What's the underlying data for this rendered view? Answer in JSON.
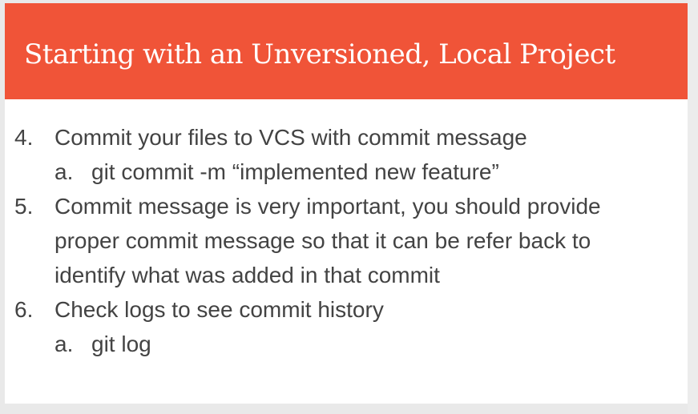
{
  "slide": {
    "title": "Starting with an Unversioned, Local Project",
    "items": [
      {
        "number": "4.",
        "lines": [
          "Commit your files to VCS with commit message"
        ],
        "sub": {
          "letter": "a.",
          "text": "git commit -m “implemented new feature”"
        }
      },
      {
        "number": "5.",
        "lines": [
          "Commit message is very important, you should provide",
          "proper commit message so that it can be refer back to",
          "identify what was added in that commit"
        ]
      },
      {
        "number": "6.",
        "lines": [
          "Check logs to see commit history"
        ],
        "sub": {
          "letter": "a.",
          "text": "git log"
        }
      }
    ]
  },
  "colors": {
    "title_bar": "#f05438",
    "title_text": "#ffffff",
    "body_text": "#434343",
    "background": "#ffffff"
  }
}
